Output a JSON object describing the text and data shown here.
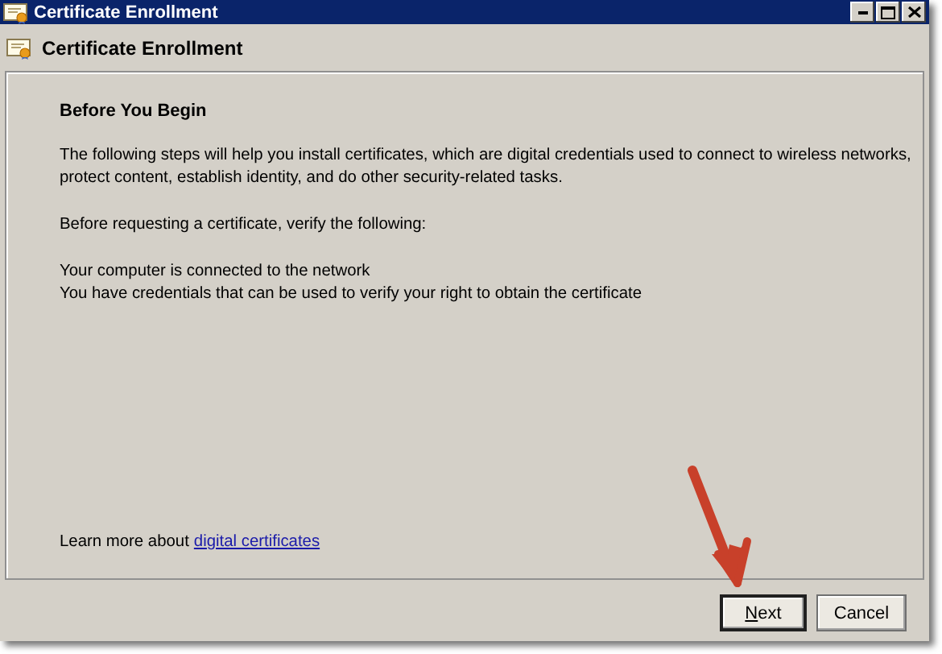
{
  "window": {
    "title": "Certificate Enrollment"
  },
  "header": {
    "title": "Certificate Enrollment"
  },
  "page": {
    "heading": "Before You Begin",
    "paragraphs": [
      "The following steps will help you install certificates, which are digital credentials used to connect to wireless networks, protect content, establish identity, and do other security-related tasks.",
      "Before requesting a certificate, verify the following:"
    ],
    "checklist": [
      "Your computer is connected to the network",
      "You have credentials that can be used to verify your right to obtain the certificate"
    ],
    "learn_more": {
      "text": "Learn more about",
      "link": "digital certificates"
    }
  },
  "buttons": [
    {
      "label": "Next",
      "default": true,
      "access_key": true
    },
    {
      "label": "Cancel",
      "default": false,
      "access_key": false
    }
  ],
  "annotation": {
    "kind": "arrow"
  }
}
